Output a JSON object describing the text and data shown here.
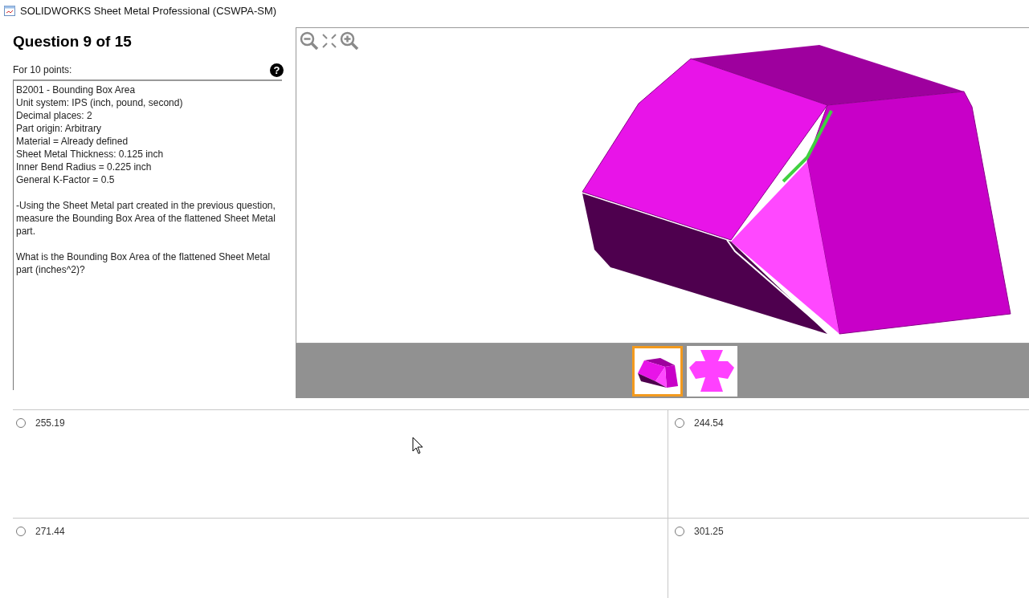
{
  "window": {
    "title": "SOLIDWORKS Sheet Metal Professional (CSWPA-SM)"
  },
  "question": {
    "title": "Question 9 of 15",
    "points": "For 10 points:",
    "help": "?",
    "paragraphs": [
      "B2001 - Bounding Box Area\nUnit system: IPS (inch, pound, second)\nDecimal places: 2\nPart origin: Arbitrary\nMaterial = Already defined\nSheet Metal Thickness: 0.125 inch\nInner Bend Radius = 0.225 inch\nGeneral K-Factor = 0.5",
      "-Using the Sheet Metal part created in the previous question, measure the Bounding Box Area of the flattened Sheet Metal part.",
      "What is the Bounding Box Area of the flattened Sheet Metal part (inches^2)?"
    ]
  },
  "viewer": {
    "thumbnails": [
      {
        "kind": "folded",
        "selected": true
      },
      {
        "kind": "flat",
        "selected": false
      }
    ]
  },
  "answers": [
    {
      "label": "255.19",
      "selected": false
    },
    {
      "label": "244.54",
      "selected": false
    },
    {
      "label": "271.44",
      "selected": false
    },
    {
      "label": "301.25",
      "selected": false
    }
  ]
}
